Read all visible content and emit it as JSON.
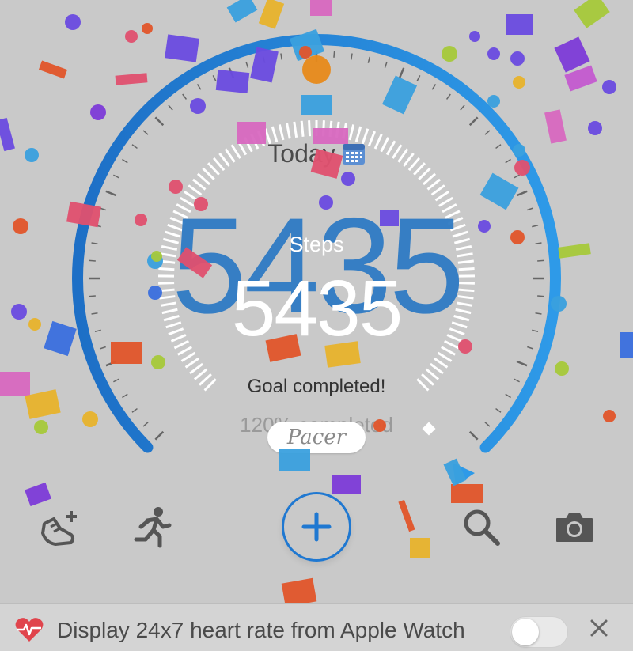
{
  "app": {
    "brand": "Pacer"
  },
  "header": {
    "date_label": "Today",
    "calendar_icon": "calendar-icon"
  },
  "steps": {
    "label": "Steps",
    "value": "5435",
    "background_value": "5435",
    "goal_status": "Goal completed!",
    "percent_text": "120% completed",
    "progress_fraction": 1.0
  },
  "toolbar": {
    "items": [
      {
        "name": "add-shoe-button",
        "icon": "shoe-plus-icon"
      },
      {
        "name": "activity-button",
        "icon": "running-person-icon"
      },
      {
        "name": "add-button",
        "icon": "plus-icon"
      },
      {
        "name": "search-button",
        "icon": "search-icon"
      },
      {
        "name": "camera-button",
        "icon": "camera-icon"
      }
    ]
  },
  "banner": {
    "text": "Display 24x7 heart rate from Apple Watch",
    "icon": "heart-rate-icon",
    "toggle_on": false,
    "close_icon": "close-icon"
  },
  "colors": {
    "background": "#c9c9c9",
    "accent": "#1f78d1",
    "accent_light": "#2e95e6",
    "steps_number": "#2f7bc4",
    "heart": "#e0444c"
  }
}
